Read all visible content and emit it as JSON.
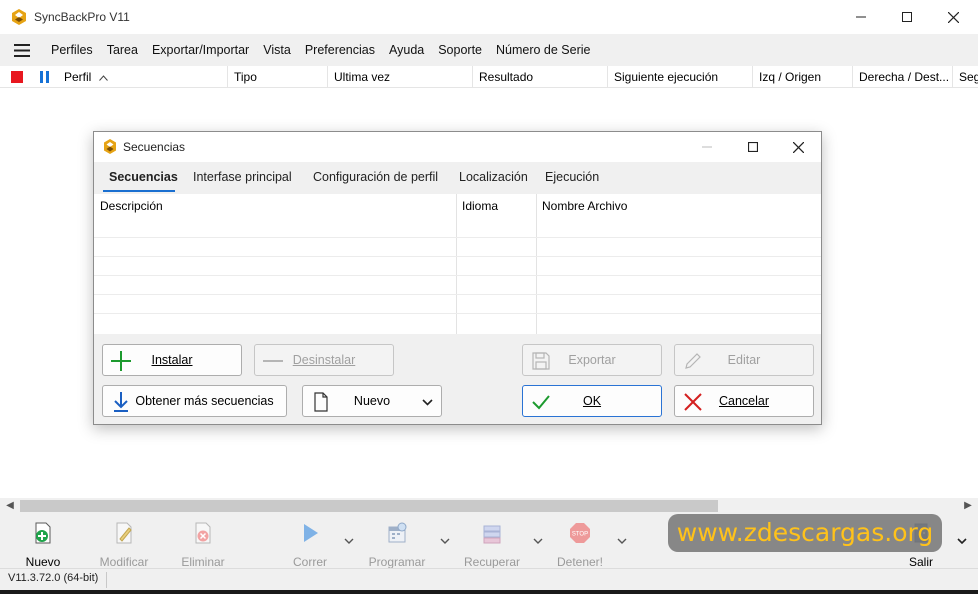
{
  "window": {
    "title": "SyncBackPro V11"
  },
  "menu": [
    "Perfiles",
    "Tarea",
    "Exportar/Importar",
    "Vista",
    "Preferencias",
    "Ayuda",
    "Soporte",
    "Número de Serie"
  ],
  "columns": [
    "Perfil",
    "Tipo",
    "Ultima vez",
    "Resultado",
    "Siguiente ejecución",
    "Izq / Origen",
    "Derecha / Dest...",
    "Seg"
  ],
  "dialog": {
    "title": "Secuencias",
    "tabs": [
      "Secuencias",
      "Interfase principal",
      "Configuración de perfil",
      "Localización",
      "Ejecución"
    ],
    "grid_headers": [
      "Descripción",
      "Idioma",
      "Nombre Archivo"
    ],
    "buttons": {
      "instalar": "Instalar",
      "desinstalar": "Desinstalar",
      "exportar": "Exportar",
      "editar": "Editar",
      "obtener": "Obtener más secuencias",
      "nuevo": "Nuevo",
      "ok": "OK",
      "cancelar": "Cancelar"
    }
  },
  "toolbar": {
    "nuevo": "Nuevo",
    "modificar": "Modificar",
    "eliminar": "Eliminar",
    "correr": "Correr",
    "programar": "Programar",
    "recuperar": "Recuperar",
    "detener": "Detener!",
    "salir": "Salir",
    "stop_sign_text": "STOP"
  },
  "watermark": "www.zdescargas.org",
  "status": {
    "version": "V11.3.72.0 (64-bit)"
  },
  "colors": {
    "accent": "#1a6fd0",
    "stop": "#e8171f",
    "watermark_text": "#ffc21a"
  }
}
